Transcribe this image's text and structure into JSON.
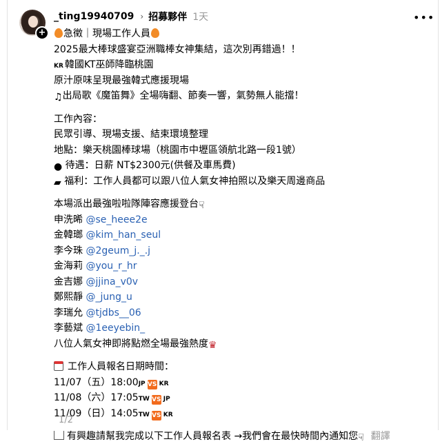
{
  "header": {
    "username": "_ting19940709",
    "group": "招募夥伴",
    "time": "1天",
    "more_icon": "more-horizontal-icon"
  },
  "post": {
    "l1": "急徵｜現場工作人員",
    "l2": "2025最大棒球盛宴亞洲職棒女神集結，這次別再錯過！！",
    "l3_flag": "KR",
    "l3": "韓國KT巫師降臨桃園",
    "l4": "原汁原味呈現最強韓式應援現場",
    "l5": "出局歌《魔笛舞》全場嗨翻、節奏一響，氣勢無人能擋！",
    "work_title": "工作內容：",
    "work": "民眾引導、現場支援、結束環境整理",
    "place": "地點：樂天桃園棒球場（桃園市中壢區領航北路一段1號）",
    "pay": "待遇：日薪 NT$2300元(供餐及車馬費)",
    "benefit": "福利：工作人員都可以跟八位人氣女神拍照以及樂天周邊商品",
    "lineup_title": "本場派出最強啦啦隊陣容應援登台",
    "members": [
      {
        "name": "申洗晞",
        "handle": "@se_heee2e"
      },
      {
        "name": "金韓瑯",
        "handle": "@kim_han_seul"
      },
      {
        "name": "李今珠",
        "handle": "@2geum_j._.j"
      },
      {
        "name": "金海莉",
        "handle": "@you_r_hr"
      },
      {
        "name": "金吉娜",
        "handle": "@jjina_v0v"
      },
      {
        "name": "鄭熙靜",
        "handle": "@_jung_u"
      },
      {
        "name": "李瑞允",
        "handle": "@tjdbs__06"
      },
      {
        "name": "李藝斌",
        "handle": "@1eeyebin_"
      }
    ],
    "closing": "八位人氣女神即將點燃全場最強熱度",
    "schedule_title": "工作人員報名日期時間：",
    "schedule": [
      {
        "date": "11/07（五）18:00",
        "a": "JP",
        "b": "KR"
      },
      {
        "date": "11/08（六）17:05",
        "a": "TW",
        "b": "JP"
      },
      {
        "date": "11/09（日）14:05",
        "a": "TW",
        "b": "KR"
      }
    ],
    "vs_label": "VS",
    "cta": "有興趣請幫我完成以下工作人員報名表 →我們會在最快時間內通知您",
    "translate": "翻譯",
    "pager": "1/2"
  }
}
